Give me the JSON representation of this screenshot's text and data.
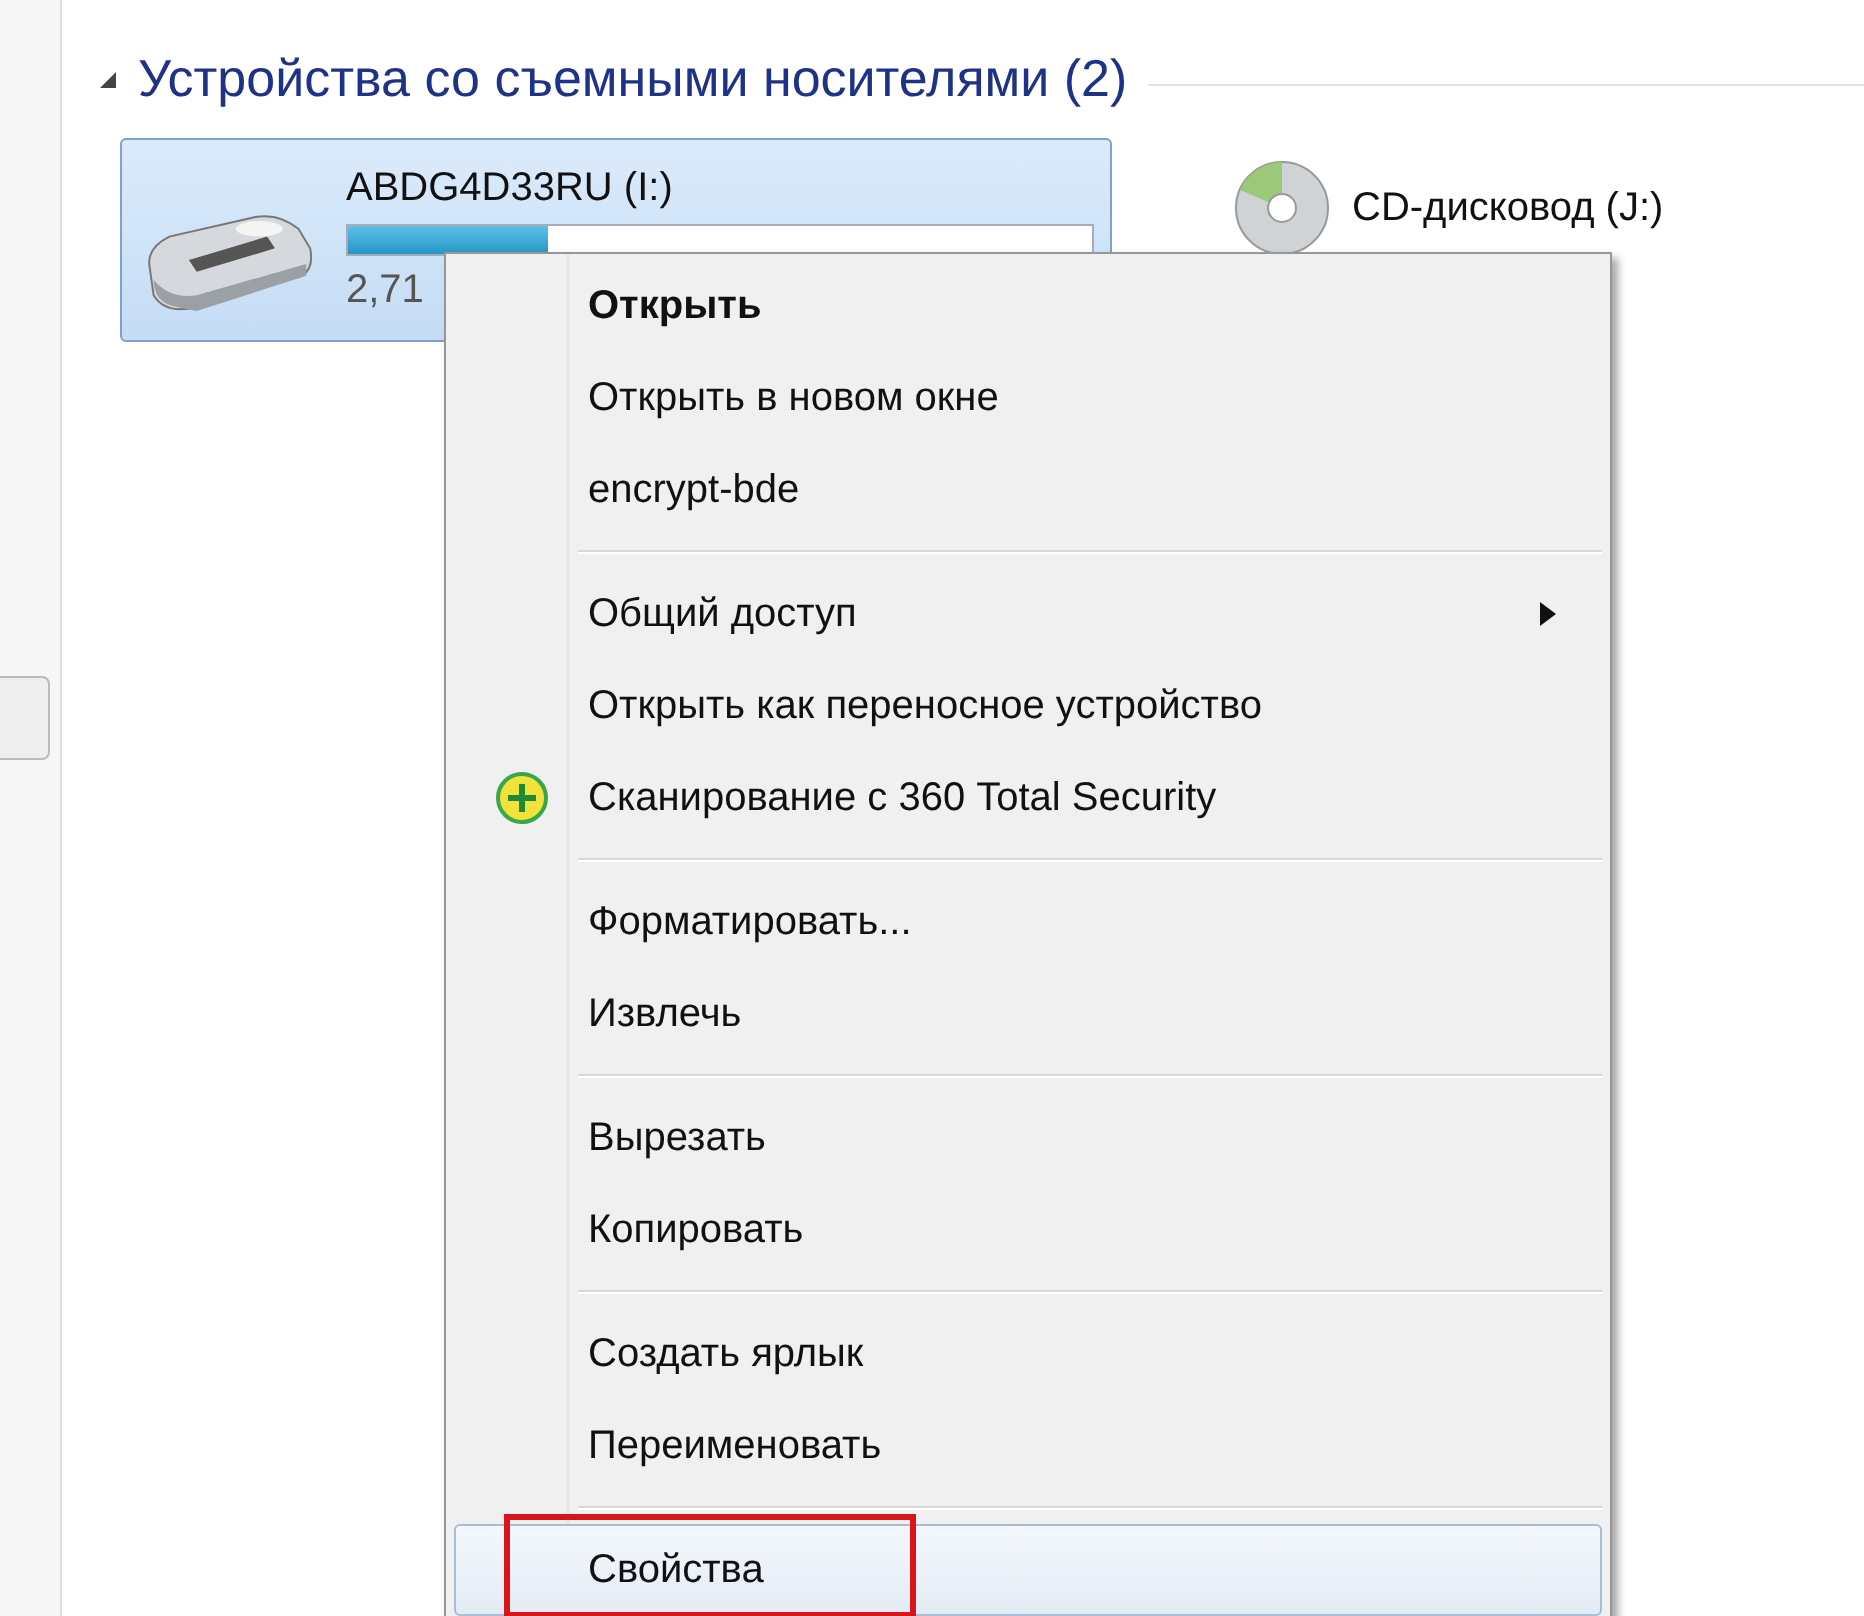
{
  "section": {
    "title": "Устройства со съемными носителями (2)",
    "expanded": true
  },
  "drive": {
    "name": "ABDG4D33RU (I:)",
    "level": 0.27,
    "size": "2,71",
    "selected": true
  },
  "cd_drive": {
    "name": "CD-дисковод (J:)"
  },
  "context_menu": {
    "groups": [
      [
        {
          "label": "Открыть",
          "default": true,
          "submenu": false,
          "kind": "plain",
          "selected": false,
          "outlined": false
        },
        {
          "label": "Открыть в новом окне",
          "default": false,
          "submenu": false,
          "kind": "plain",
          "selected": false,
          "outlined": false
        },
        {
          "label": "encrypt-bde",
          "default": false,
          "submenu": false,
          "kind": "plain",
          "selected": false,
          "outlined": false
        }
      ],
      [
        {
          "label": "Общий доступ",
          "default": false,
          "submenu": true,
          "kind": "plain",
          "selected": false,
          "outlined": false
        },
        {
          "label": "Открыть как переносное устройство",
          "default": false,
          "submenu": false,
          "kind": "plain",
          "selected": false,
          "outlined": false
        },
        {
          "label": "Сканирование с 360 Total Security",
          "default": false,
          "submenu": false,
          "kind": "scan",
          "selected": false,
          "outlined": false
        }
      ],
      [
        {
          "label": "Форматировать...",
          "default": false,
          "submenu": false,
          "kind": "plain",
          "selected": false,
          "outlined": false
        },
        {
          "label": "Извлечь",
          "default": false,
          "submenu": false,
          "kind": "plain",
          "selected": false,
          "outlined": false
        }
      ],
      [
        {
          "label": "Вырезать",
          "default": false,
          "submenu": false,
          "kind": "plain",
          "selected": false,
          "outlined": false
        },
        {
          "label": "Копировать",
          "default": false,
          "submenu": false,
          "kind": "plain",
          "selected": false,
          "outlined": false
        }
      ],
      [
        {
          "label": "Создать ярлык",
          "default": false,
          "submenu": false,
          "kind": "plain",
          "selected": false,
          "outlined": false
        },
        {
          "label": "Переименовать",
          "default": false,
          "submenu": false,
          "kind": "plain",
          "selected": false,
          "outlined": false
        }
      ],
      [
        {
          "label": "Свойства",
          "default": false,
          "submenu": false,
          "kind": "plain",
          "selected": true,
          "outlined": true
        }
      ]
    ]
  }
}
